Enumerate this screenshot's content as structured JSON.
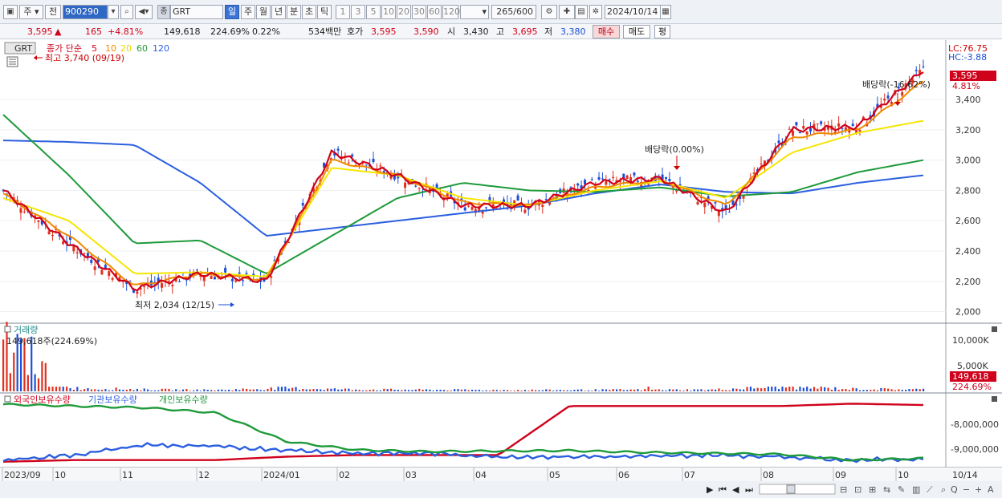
{
  "toolbar": {
    "period_tabs": [
      "주",
      "전"
    ],
    "code": "900290",
    "name_tag": "종",
    "name": "GRT",
    "interval_tabs": [
      "일",
      "주",
      "월",
      "년",
      "분",
      "초",
      "틱"
    ],
    "interval_active": "일",
    "numbers": [
      "1",
      "3",
      "5",
      "10",
      "20",
      "30",
      "60",
      "120"
    ],
    "count": "265",
    "count_total": "/600",
    "date": "2024/10/14"
  },
  "quote": {
    "price": "3,595",
    "change": "165",
    "change_pct": "+4.81%",
    "volume": "149,618",
    "volume_pct": "224.69%",
    "turnover": "0.22%",
    "value": "534백만",
    "ask_label": "호가",
    "ask": "3,595",
    "bid": "3,590",
    "open_label": "시",
    "open": "3,430",
    "high_label": "고",
    "high": "3,695",
    "low_label": "저",
    "low": "3,380",
    "buy_label": "매수",
    "sell_label": "매도",
    "eval_label": "평"
  },
  "price_panel": {
    "tag": "GRT",
    "ma_title": "종가 단순",
    "ma_periods": [
      "5",
      "10",
      "20",
      "60",
      "120"
    ],
    "ma_colors": [
      "#d0021b",
      "#f08a00",
      "#f5e600",
      "#1e9a3a",
      "#2b5fe0"
    ],
    "high_note": "최고 3,740 (09/19)",
    "low_note": "최저 2,034 (12/15)",
    "ex_div_1": "배당락(0.00%)",
    "ex_div_2": "배당락(-16.62%)",
    "lc": "LC:76.75",
    "hc": "HC:-3.88",
    "last_price_tag": "3,595",
    "last_change_tag": "4.81%",
    "y_ticks": [
      "3,400",
      "3,200",
      "3,000",
      "2,800",
      "2,600",
      "2,400",
      "2,200",
      "2,000"
    ]
  },
  "volume_panel": {
    "title": "거래량",
    "note": "149,618주(224.69%)",
    "y_ticks": [
      "10,000K",
      "5,000K"
    ],
    "last_tag": "149,618",
    "last_pct": "224.69%"
  },
  "holding_panel": {
    "series": [
      "외국인보유수량",
      "기관보유수량",
      "개인보유수량"
    ],
    "colors": [
      "#d0021b",
      "#2b5fe0",
      "#1e9a3a"
    ],
    "y_ticks": [
      "-8,000,000",
      "-9,000,000"
    ]
  },
  "x_axis": {
    "labels": [
      "2023/09",
      "10",
      "11",
      "12",
      "2024/01",
      "02",
      "03",
      "04",
      "05",
      "06",
      "07",
      "08",
      "09",
      "10",
      "10/14"
    ]
  },
  "chart_data": [
    {
      "type": "line",
      "title": "GRT",
      "subtitle": "종가 단순 5 10 20 60 120",
      "x": [
        "2023/09",
        "10",
        "11",
        "12",
        "2024/01",
        "02",
        "03",
        "04",
        "05",
        "06",
        "07",
        "08",
        "09",
        "10"
      ],
      "series": [
        {
          "name": "5",
          "values": [
            2800,
            2450,
            2150,
            2250,
            2200,
            3050,
            2900,
            2700,
            2700,
            2850,
            2880,
            2650,
            3200,
            3220,
            3595
          ]
        },
        {
          "name": "10",
          "values": [
            2780,
            2500,
            2170,
            2250,
            2210,
            3000,
            2900,
            2720,
            2700,
            2820,
            2870,
            2700,
            3150,
            3200,
            3520
          ]
        },
        {
          "name": "20",
          "values": [
            2750,
            2600,
            2250,
            2260,
            2230,
            2950,
            2900,
            2750,
            2700,
            2800,
            2860,
            2750,
            3050,
            3180,
            3260
          ]
        },
        {
          "name": "60",
          "values": [
            3300,
            2900,
            2450,
            2470,
            2250,
            2500,
            2750,
            2850,
            2800,
            2790,
            2820,
            2760,
            2790,
            2920,
            3000
          ]
        },
        {
          "name": "120",
          "values": [
            3130,
            3120,
            3100,
            2850,
            2500,
            2550,
            2600,
            2650,
            2700,
            2780,
            2840,
            2790,
            2780,
            2850,
            2900
          ]
        }
      ],
      "ylim": [
        1950,
        3750
      ],
      "annotations": [
        "최고 3,740 (09/19)",
        "최저 2,034 (12/15)",
        "배당락(0.00%)",
        "배당락(-16.62%)"
      ]
    },
    {
      "type": "bar",
      "title": "거래량",
      "x": [
        "2023/09",
        "10",
        "11",
        "12",
        "2024/01",
        "02",
        "03",
        "04",
        "05",
        "06",
        "07",
        "08",
        "09",
        "10"
      ],
      "values": [
        10500,
        600,
        350,
        250,
        600,
        350,
        300,
        250,
        250,
        300,
        300,
        900,
        450,
        350
      ],
      "ylabel": "K",
      "ylim": [
        0,
        12000
      ]
    },
    {
      "type": "line",
      "title": "보유수량",
      "x": [
        "2023/09",
        "10",
        "11",
        "12",
        "2024/01",
        "02",
        "03",
        "04",
        "05",
        "06",
        "07",
        "08",
        "09",
        "10"
      ],
      "series": [
        {
          "name": "외국인보유수량",
          "values": [
            -9200000,
            -9150000,
            -9150000,
            -9150000,
            -9050000,
            -9000000,
            -9000000,
            -9000000,
            -7550000,
            -7550000,
            -7550000,
            -7550000,
            -7480000,
            -7520000
          ]
        },
        {
          "name": "기관보유수량",
          "values": [
            -9150000,
            -9000000,
            -8700000,
            -8750000,
            -8850000,
            -8950000,
            -8950000,
            -9050000,
            -9050000,
            -9050000,
            -9000000,
            -9050000,
            -9150000,
            -9120000
          ]
        },
        {
          "name": "개인보유수량",
          "values": [
            -7500000,
            -7550000,
            -7600000,
            -7750000,
            -8600000,
            -8850000,
            -8900000,
            -8880000,
            -8870000,
            -8920000,
            -8950000,
            -8980000,
            -9150000,
            -9100000
          ]
        }
      ],
      "ylim": [
        -9300000,
        -7400000
      ]
    }
  ]
}
